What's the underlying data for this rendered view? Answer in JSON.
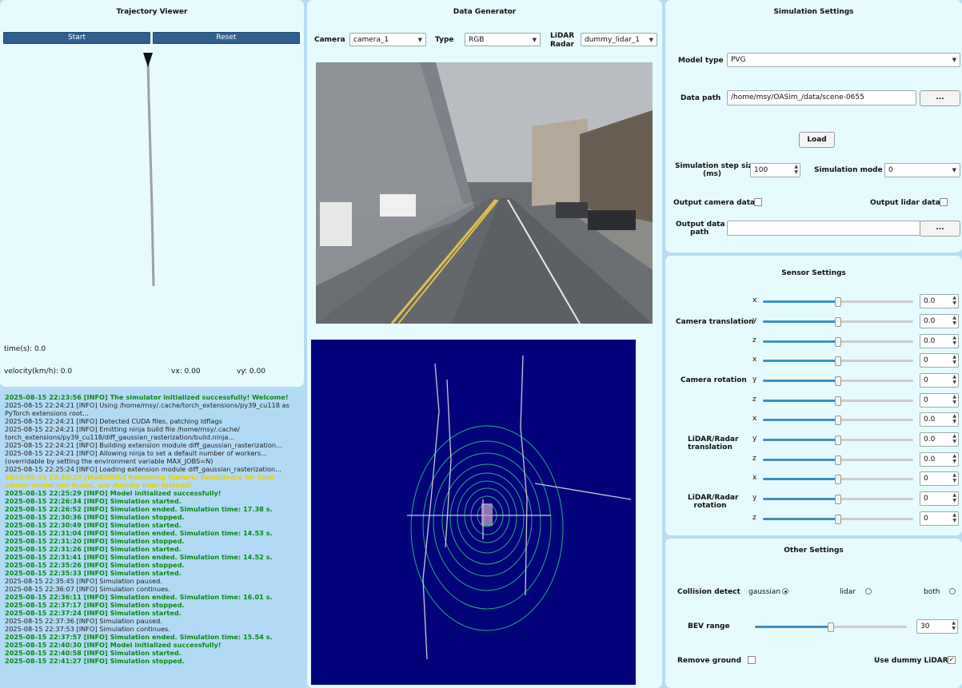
{
  "trajectory_viewer": {
    "title": "Trajectory Viewer",
    "start_label": "Start",
    "reset_label": "Reset",
    "time_label": "time(s): 0.0",
    "velocity_label": "velocity(km/h): 0.0",
    "vx_label": "vx: 0.00",
    "vy_label": "vy: 0.00"
  },
  "data_generator": {
    "title": "Data Generator",
    "camera_label": "Camera",
    "camera_value": "camera_1",
    "type_label": "Type",
    "type_value": "RGB",
    "lidar_label_1": "LiDAR",
    "lidar_label_2": "Radar",
    "lidar_value": "dummy_lidar_1"
  },
  "simulation_settings": {
    "title": "Simulation Settings",
    "model_type_label": "Model type",
    "model_type_value": "PVG",
    "data_path_label": "Data path",
    "data_path_value": "/home/msy/OASim_/data/scene-0655",
    "browse_label": "...",
    "load_label": "Load",
    "step_label_1": "Simulation step size",
    "step_label_2": "(ms)",
    "step_value": "100",
    "mode_label": "Simulation mode",
    "mode_value": "0",
    "output_camera_label": "Output camera data",
    "output_lidar_label": "Output lidar data",
    "output_path_label_1": "Output data",
    "output_path_label_2": "path",
    "output_path_value": "",
    "output_browse_label": "..."
  },
  "sensor_settings": {
    "title": "Sensor Settings",
    "group_labels": [
      "Camera translation",
      "Camera rotation",
      "LiDAR/Radar translation",
      "LiDAR/Radar rotation"
    ],
    "rows": [
      {
        "axis": "x",
        "value": "0.0"
      },
      {
        "axis": "y",
        "value": "0.0"
      },
      {
        "axis": "z",
        "value": "0.0"
      },
      {
        "axis": "x",
        "value": "0"
      },
      {
        "axis": "y",
        "value": "0"
      },
      {
        "axis": "z",
        "value": "0"
      },
      {
        "axis": "x",
        "value": "0.0"
      },
      {
        "axis": "y",
        "value": "0.0"
      },
      {
        "axis": "z",
        "value": "0.0"
      },
      {
        "axis": "x",
        "value": "0"
      },
      {
        "axis": "y",
        "value": "0"
      },
      {
        "axis": "z",
        "value": "0"
      }
    ]
  },
  "other_settings": {
    "title": "Other Settings",
    "collision_label": "Collision detect",
    "opt_gaussian": "gaussian",
    "opt_lidar": "lidar",
    "opt_both": "both",
    "bev_label": "BEV range",
    "bev_value": "30",
    "remove_ground_label": "Remove ground",
    "use_dummy_label": "Use dummy LiDAR",
    "use_dummy_check": "✓"
  },
  "log": [
    {
      "s": "g",
      "t": "2025-08-15 22:23:56 [INFO] The simulator initialized successfully! Welcome!"
    },
    {
      "s": "n",
      "t": "2025-08-15 22:24:21 [INFO] Using /home/msy/.cache/torch_extensions/py39_cu118 as PyTorch extensions root..."
    },
    {
      "s": "n",
      "t": "2025-08-15 22:24:21 [INFO] Detected CUDA files, patching ldflags"
    },
    {
      "s": "n",
      "t": "2025-08-15 22:24:21 [INFO] Emitting ninja build file /home/msy/.cache/ torch_extensions/py39_cu118/diff_gaussian_rasterization/build.ninja..."
    },
    {
      "s": "n",
      "t": "2025-08-15 22:24:21 [INFO] Building extension module diff_gaussian_rasterization..."
    },
    {
      "s": "n",
      "t": "2025-08-15 22:24:21 [INFO] Allowing ninja to set a default number of workers... (overridable by setting the environment variable MAX_JOBS=N)"
    },
    {
      "s": "n",
      "t": "2025-08-15 22:25:24 [INFO] Loading extension module diff_gaussian_rasterization..."
    },
    {
      "s": "y",
      "t": "2025-08-15 22:25:29 [WARNING] Rendering feature: Recalibrate for lidar sensor model not found, use dummy lidar instead!"
    },
    {
      "s": "g",
      "t": "2025-08-15 22:25:29 [INFO] Model initialized successfully!"
    },
    {
      "s": "g",
      "t": "2025-08-15 22:26:34 [INFO] Simulation started."
    },
    {
      "s": "g",
      "t": "2025-08-15 22:26:52 [INFO] Simulation ended. Simulation time: 17.38 s."
    },
    {
      "s": "g",
      "t": "2025-08-15 22:30:36 [INFO] Simulation stopped."
    },
    {
      "s": "g",
      "t": "2025-08-15 22:30:49 [INFO] Simulation started."
    },
    {
      "s": "g",
      "t": "2025-08-15 22:31:04 [INFO] Simulation ended. Simulation time: 14.53 s."
    },
    {
      "s": "g",
      "t": "2025-08-15 22:31:20 [INFO] Simulation stopped."
    },
    {
      "s": "g",
      "t": "2025-08-15 22:31:26 [INFO] Simulation started."
    },
    {
      "s": "g",
      "t": "2025-08-15 22:31:41 [INFO] Simulation ended. Simulation time: 14.52 s."
    },
    {
      "s": "g",
      "t": "2025-08-15 22:35:26 [INFO] Simulation stopped."
    },
    {
      "s": "g",
      "t": "2025-08-15 22:35:33 [INFO] Simulation started."
    },
    {
      "s": "n",
      "t": "2025-08-15 22:35:45 [INFO] Simulation paused."
    },
    {
      "s": "n",
      "t": "2025-08-15 22:36:07 [INFO] Simulation continues."
    },
    {
      "s": "g",
      "t": "2025-08-15 22:36:11 [INFO] Simulation ended. Simulation time: 16.01 s."
    },
    {
      "s": "g",
      "t": "2025-08-15 22:37:17 [INFO] Simulation stopped."
    },
    {
      "s": "g",
      "t": "2025-08-15 22:37:24 [INFO] Simulation started."
    },
    {
      "s": "n",
      "t": "2025-08-15 22:37:36 [INFO] Simulation paused."
    },
    {
      "s": "n",
      "t": "2025-08-15 22:37:53 [INFO] Simulation continues."
    },
    {
      "s": "g",
      "t": "2025-08-15 22:37:57 [INFO] Simulation ended. Simulation time: 15.54 s."
    },
    {
      "s": "g",
      "t": "2025-08-15 22:40:30 [INFO] Model initialized successfully!"
    },
    {
      "s": "g",
      "t": "2025-08-15 22:40:58 [INFO] Simulation started."
    },
    {
      "s": "g",
      "t": "2025-08-15 22:41:27 [INFO] Simulation stopped."
    }
  ]
}
